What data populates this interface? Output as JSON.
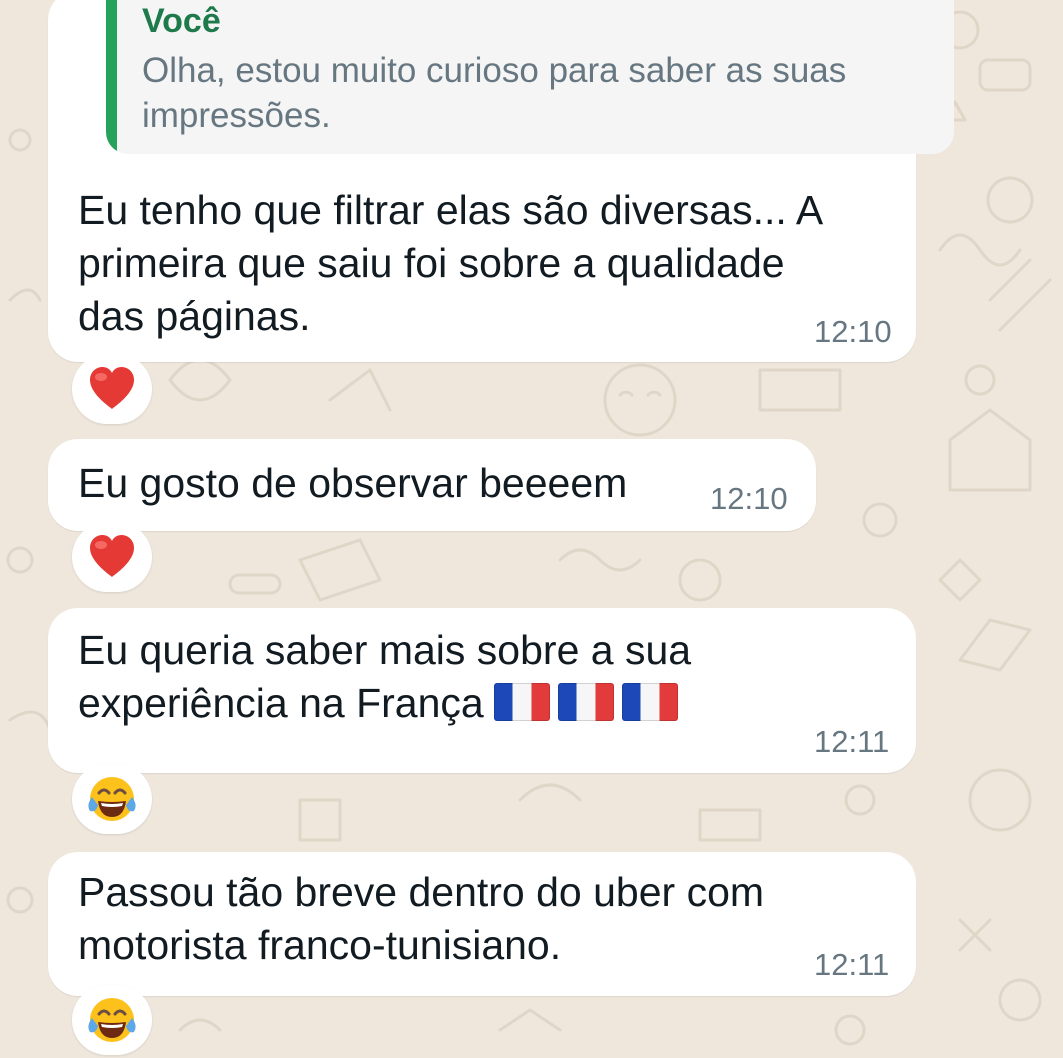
{
  "colors": {
    "background": "#efe7dc",
    "bubble": "#ffffff",
    "quote_background": "#f5f5f5",
    "quote_accent": "#25a35a",
    "quote_author": "#1f7a4b",
    "text": "#111b21",
    "meta_text": "#667781",
    "heart_red": "#e53935"
  },
  "quoted_message": {
    "author": "Você",
    "text": "Olha, estou muito curioso para saber as suas impressões."
  },
  "messages": [
    {
      "text": "Eu tenho que filtrar elas são diversas... A\nprimeira que saiu foi sobre a qualidade\ndas páginas.",
      "time": "12:10",
      "reaction": "red-heart"
    },
    {
      "text": "Eu gosto de observar beeeem",
      "time": "12:10",
      "reaction": "red-heart"
    },
    {
      "text": "Eu queria saber mais sobre a sua\nexperiência na França",
      "time": "12:11",
      "flags": [
        "france-flag",
        "france-flag",
        "france-flag"
      ],
      "reaction": "tears-of-joy-face"
    },
    {
      "text": "Passou tão breve dentro do uber com\nmotorista franco-tunisiano.",
      "time": "12:11",
      "reaction": "tears-of-joy-face"
    }
  ]
}
